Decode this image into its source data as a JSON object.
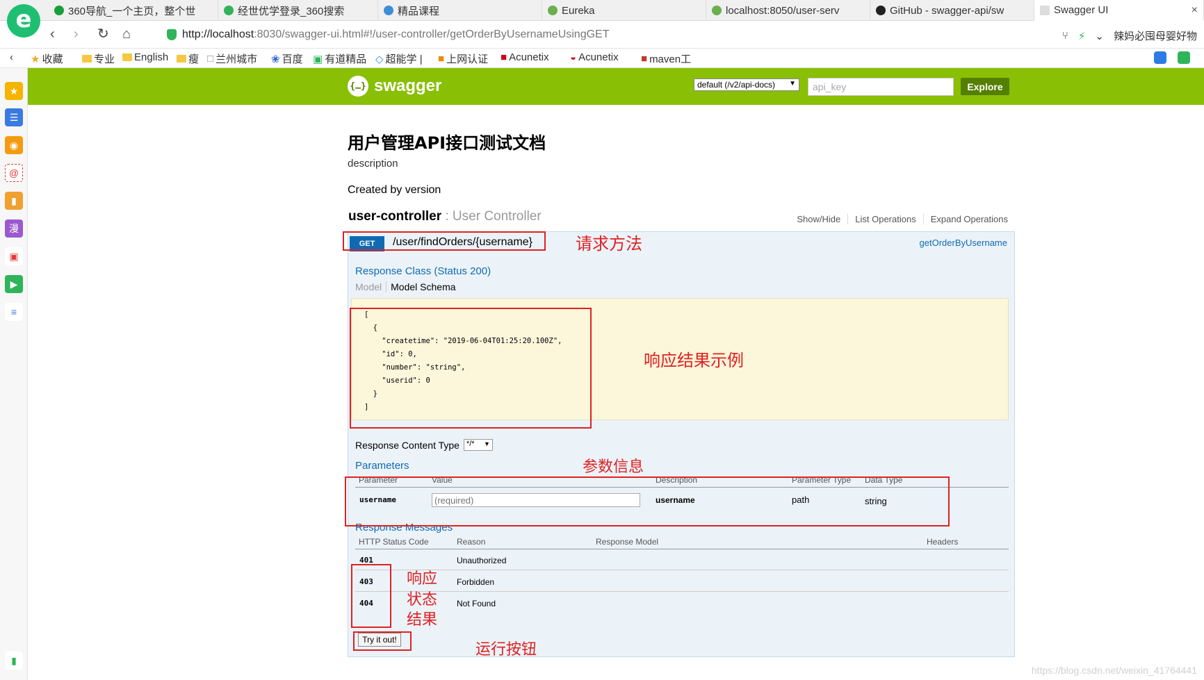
{
  "browser": {
    "logo_letter": "e",
    "tabs": [
      {
        "label": "360导航_一个主页，整个世",
        "color": "#1a9e3a"
      },
      {
        "label": "经世优学登录_360搜索",
        "color": "#2fb45a"
      },
      {
        "label": "精品课程",
        "color": "#3b8ed8"
      },
      {
        "label": "Eureka",
        "color": "#6ab04c"
      },
      {
        "label": "localhost:8050/user-serv",
        "color": "#6ab04c"
      },
      {
        "label": "GitHub - swagger-api/sw",
        "color": "#222222"
      },
      {
        "label": "Swagger UI",
        "color": "#dddddd"
      }
    ],
    "close_glyph": "×",
    "url_host": "http://localhost",
    "url_rest": ":8030/swagger-ui.html#!/user-controller/getOrderByUsernameUsingGET",
    "search_hint": "辣妈必囤母婴好物",
    "bookmarks": [
      "收藏",
      "专业",
      "English",
      "瘦",
      "兰州城市",
      "百度",
      "有道精品",
      "超能学 |",
      "上网认证",
      "Acunetix",
      "Acunetix",
      "maven工"
    ]
  },
  "swagger": {
    "logo_text": "swagger",
    "logo_glyph": "{…}",
    "spec_select": "default (/v2/api-docs)",
    "api_key_placeholder": "api_key",
    "explore_label": "Explore"
  },
  "doc": {
    "title": "用户管理API接口测试文档",
    "description": "description",
    "version_text": "Created by version",
    "controller_name": "user-controller",
    "controller_desc": " : User Controller",
    "links": [
      "Show/Hide",
      "List Operations",
      "Expand Operations"
    ]
  },
  "operation": {
    "method": "GET",
    "path": "/user/findOrders/{username}",
    "nickname": "getOrderByUsername",
    "response_class_heading": "Response Class (Status 200)",
    "model_tab": "Model",
    "schema_tab": "Model Schema",
    "schema_json": "[\n  {\n    \"createtime\": \"2019-06-04T01:25:20.100Z\",\n    \"id\": 0,\n    \"number\": \"string\",\n    \"userid\": 0\n  }\n]",
    "content_type_label": "Response Content Type",
    "content_type_value": "*/*",
    "parameters_heading": "Parameters",
    "param_headers": [
      "Parameter",
      "Value",
      "Description",
      "Parameter Type",
      "Data Type"
    ],
    "param_row": {
      "name": "username",
      "placeholder": "(required)",
      "description": "username",
      "param_type": "path",
      "data_type": "string"
    },
    "messages_heading": "Response Messages",
    "message_headers": [
      "HTTP Status Code",
      "Reason",
      "Response Model",
      "Headers"
    ],
    "messages": [
      {
        "code": "401",
        "reason": "Unauthorized"
      },
      {
        "code": "403",
        "reason": "Forbidden"
      },
      {
        "code": "404",
        "reason": "Not Found"
      }
    ],
    "try_label": "Try it out!"
  },
  "annotations": {
    "method": "请求方法",
    "response_example": "响应结果示例",
    "params": "参数信息",
    "status_1": "响应",
    "status_2": "状态",
    "status_3": "结果",
    "run_button": "运行按钮"
  },
  "watermark": "https://blog.csdn.net/weixin_41764441",
  "colors": {
    "swagger_green": "#89bf04",
    "get_blue": "#0f6ab4",
    "annotation_red": "#e02020"
  }
}
